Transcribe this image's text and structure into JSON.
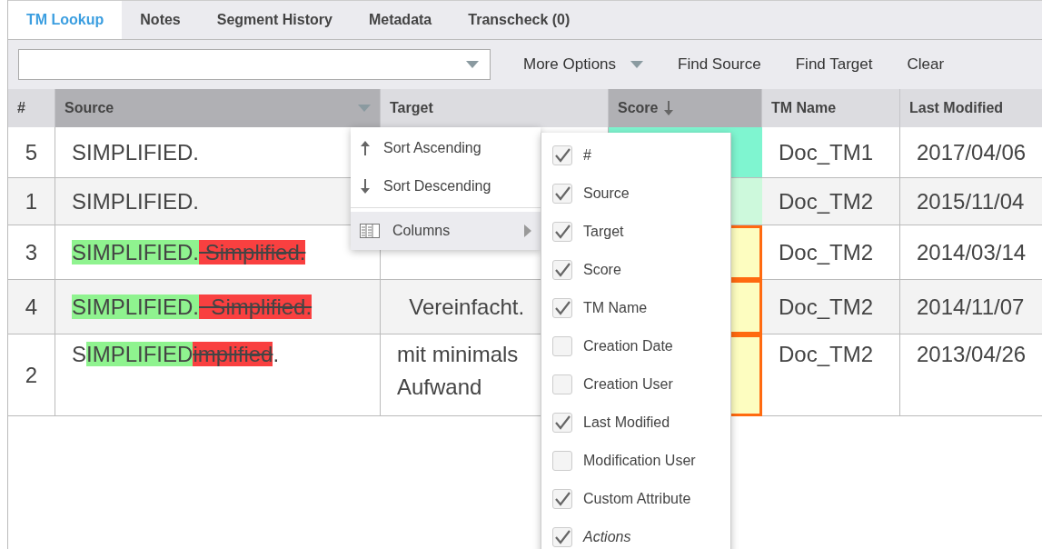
{
  "tabs": [
    {
      "label": "TM Lookup",
      "selected": true
    },
    {
      "label": "Notes",
      "selected": false
    },
    {
      "label": "Segment History",
      "selected": false
    },
    {
      "label": "Metadata",
      "selected": false
    },
    {
      "label": "Transcheck (0)",
      "selected": false
    }
  ],
  "toolbar": {
    "buttons": [
      {
        "label": "More Options",
        "kind": "dropdown"
      },
      {
        "label": "Find Source",
        "kind": "plain"
      },
      {
        "label": "Find Target",
        "kind": "plain"
      },
      {
        "label": "Clear",
        "kind": "plain"
      }
    ]
  },
  "table": {
    "columns": [
      {
        "label": "#",
        "active": false,
        "sorted": false,
        "menu": false
      },
      {
        "label": "Source",
        "active": true,
        "sorted": false,
        "menu": true
      },
      {
        "label": "Target",
        "active": false,
        "sorted": false,
        "menu": false
      },
      {
        "label": "Score",
        "active": true,
        "sorted": true,
        "menu": false
      },
      {
        "label": "TM Name",
        "active": false,
        "sorted": false,
        "menu": false
      },
      {
        "label": "Last Modified",
        "active": false,
        "sorted": false,
        "menu": false
      }
    ],
    "rows": [
      {
        "number": "5",
        "source": [
          {
            "kind": "plain",
            "text": "SIMPLIFIED."
          }
        ],
        "target": "",
        "color": "#7ff5d0",
        "fuzzy": false,
        "tm_name": "Doc_TM1",
        "last_modified": "2017/04/06"
      },
      {
        "number": "1",
        "source": [
          {
            "kind": "plain",
            "text": "SIMPLIFIED."
          }
        ],
        "target": "",
        "color": "#cdf9dc",
        "fuzzy": false,
        "tm_name": "Doc_TM2",
        "last_modified": "2015/11/04"
      },
      {
        "number": "3",
        "source": [
          {
            "kind": "inserted",
            "text": "SIMPLIFIED."
          },
          {
            "kind": "deleted",
            "text": " Simplified."
          }
        ],
        "target": "",
        "color": "#fdfdc0",
        "fuzzy": true,
        "tm_name": "Doc_TM2",
        "last_modified": "2014/03/14"
      },
      {
        "number": "4",
        "source": [
          {
            "kind": "inserted",
            "text": "SIMPLIFIED."
          },
          {
            "kind": "deleted",
            "text": "  Simplified."
          }
        ],
        "target": "  Vereinfacht.",
        "color": "#fdfdc0",
        "fuzzy": true,
        "tm_name": "Doc_TM2",
        "last_modified": "2014/11/07"
      },
      {
        "number": "2",
        "source": [
          {
            "kind": "plain",
            "text": "S"
          },
          {
            "kind": "inserted",
            "text": "IMPLIFIED"
          },
          {
            "kind": "deleted",
            "text": "implified"
          },
          {
            "kind": "plain",
            "text": "."
          }
        ],
        "target": "mit minimals\nAufwand",
        "color": "#fdfdc0",
        "fuzzy": true,
        "tm_name": "Doc_TM2",
        "last_modified": "2013/04/26"
      }
    ]
  },
  "column_menu": {
    "items": [
      {
        "label": "Sort Ascending",
        "kind": "sort_asc",
        "hovered": false
      },
      {
        "label": "Sort Descending",
        "kind": "sort_desc",
        "hovered": false
      },
      {
        "label": "Columns",
        "kind": "submenu",
        "hovered": true
      }
    ]
  },
  "columns_submenu": {
    "items": [
      {
        "label": "#",
        "checked": true,
        "italic": false
      },
      {
        "label": "Source",
        "checked": true,
        "italic": false
      },
      {
        "label": "Target",
        "checked": true,
        "italic": false
      },
      {
        "label": "Score",
        "checked": true,
        "italic": false
      },
      {
        "label": "TM Name",
        "checked": true,
        "italic": false
      },
      {
        "label": "Creation Date",
        "checked": false,
        "italic": false
      },
      {
        "label": "Creation User",
        "checked": false,
        "italic": false
      },
      {
        "label": "Last Modified",
        "checked": true,
        "italic": false
      },
      {
        "label": "Modification User",
        "checked": false,
        "italic": false
      },
      {
        "label": "Custom Attribute",
        "checked": true,
        "italic": false
      },
      {
        "label": "Actions",
        "checked": true,
        "italic": true
      }
    ]
  }
}
